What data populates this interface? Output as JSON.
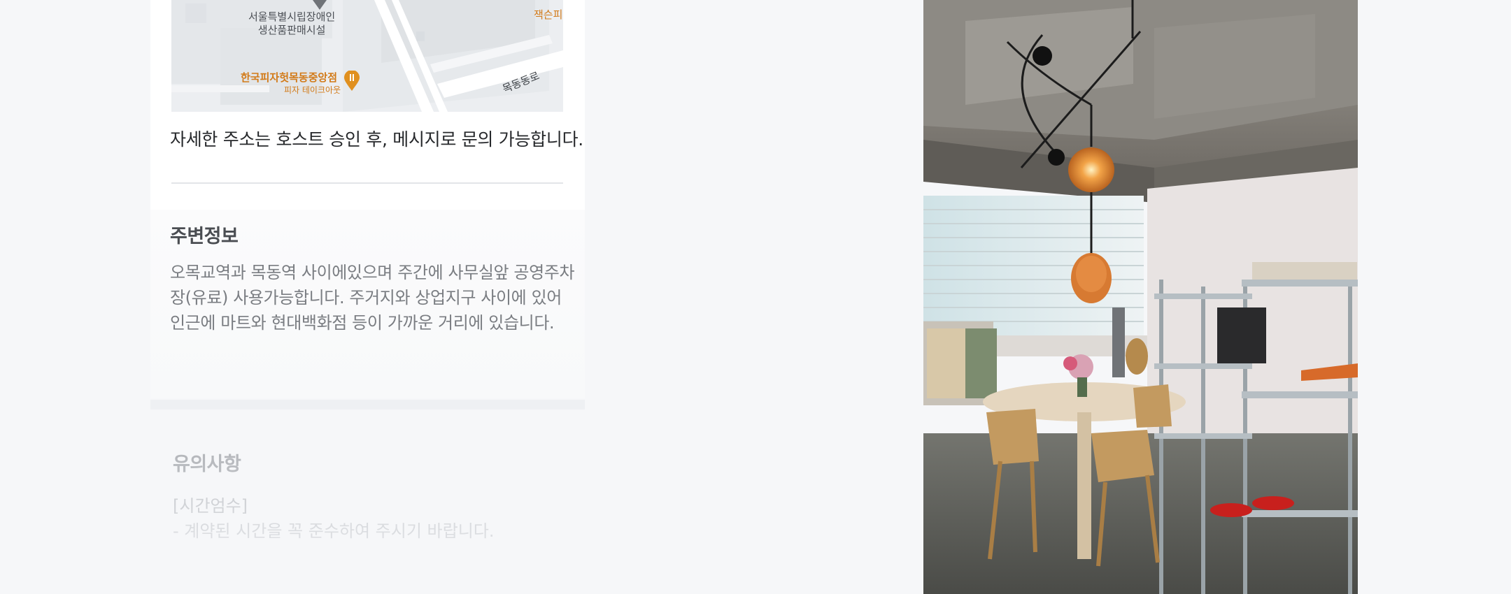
{
  "map": {
    "label_building_1": "서울특별시립장애인",
    "label_building_2": "생산품판매시설",
    "label_pizza": "한국피자헛목동중앙점",
    "label_pizza_sub": "피자 테이크아웃",
    "label_road": "목동동로",
    "label_edge": "잭슨피"
  },
  "address_note": "자세한 주소는 호스트 승인 후, 메시지로 문의 가능합니다.",
  "nearby": {
    "title": "주변정보",
    "body": "오목교역과 목동역 사이에있으며 주간에 사무실앞 공영주차장(유료) 사용가능합니다.  주거지와 상업지구 사이에 있어 인근에 마트와 현대백화점 등이 가까운 거리에 있습니다."
  },
  "notice": {
    "title": "유의사항",
    "line1": "[시간엄수]",
    "line2": "- 계약된 시간을 꼭 준수하여 주시기 바랍니다."
  },
  "photo": {
    "icon": "space-photo"
  }
}
